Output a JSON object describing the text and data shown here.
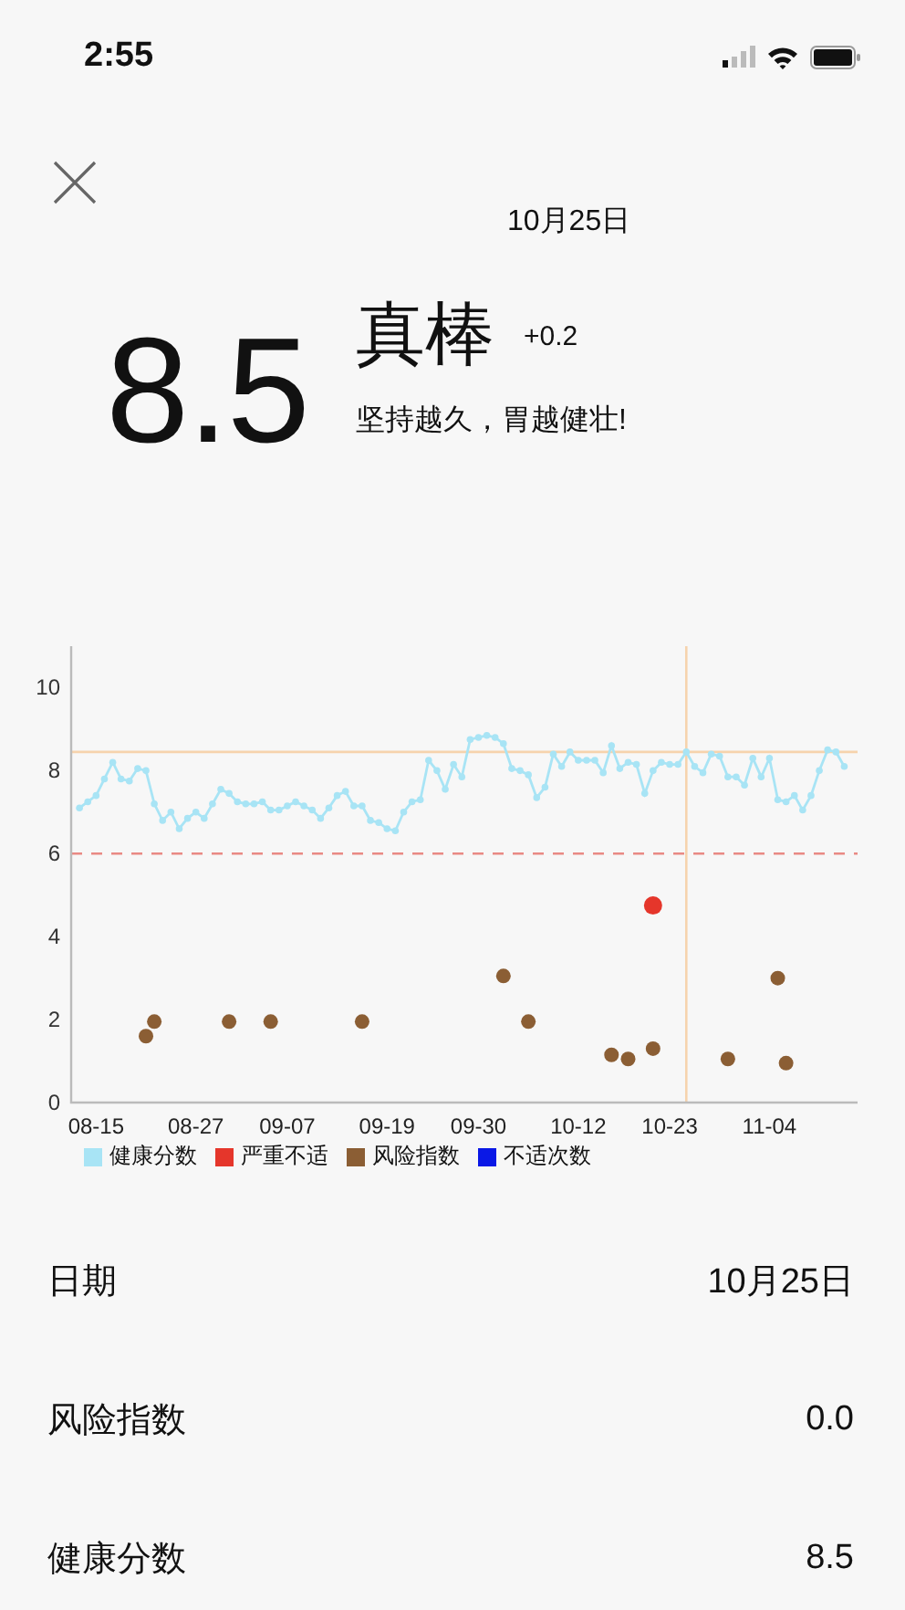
{
  "status_bar": {
    "time": "2:55"
  },
  "header": {
    "date": "10月25日",
    "score": "8.5",
    "rating": "真棒",
    "change": "+0.2",
    "message": "坚持越久，胃越健壮!"
  },
  "chart": {
    "chart_data": {
      "type": "line",
      "ylim": [
        0,
        11
      ],
      "yticks": [
        0,
        2,
        4,
        6,
        8,
        10
      ],
      "categories": [
        null,
        null,
        "08-15",
        null,
        null,
        null,
        null,
        null,
        null,
        null,
        null,
        null,
        null,
        null,
        "08-27",
        null,
        null,
        null,
        null,
        null,
        null,
        null,
        null,
        null,
        null,
        "09-07",
        null,
        null,
        null,
        null,
        null,
        null,
        null,
        null,
        null,
        null,
        null,
        "09-19",
        null,
        null,
        null,
        null,
        null,
        null,
        null,
        null,
        null,
        null,
        "09-30",
        null,
        null,
        null,
        null,
        null,
        null,
        null,
        null,
        null,
        null,
        null,
        "10-12",
        null,
        null,
        null,
        null,
        null,
        null,
        null,
        null,
        null,
        null,
        "10-23",
        null,
        null,
        null,
        null,
        null,
        null,
        null,
        null,
        null,
        null,
        null,
        "11-04",
        null,
        null,
        null,
        null,
        null,
        null,
        null,
        null,
        null
      ],
      "series": [
        {
          "name": "健康分数",
          "color": "#a8e4f5",
          "type": "line",
          "marker": true,
          "values": [
            7.1,
            7.25,
            7.4,
            7.8,
            8.2,
            7.8,
            7.75,
            8.05,
            8.0,
            7.2,
            6.8,
            7.0,
            6.6,
            6.85,
            7.0,
            6.85,
            7.2,
            7.55,
            7.45,
            7.25,
            7.2,
            7.2,
            7.25,
            7.05,
            7.05,
            7.15,
            7.25,
            7.15,
            7.05,
            6.85,
            7.1,
            7.4,
            7.5,
            7.15,
            7.15,
            6.8,
            6.75,
            6.6,
            6.55,
            7.0,
            7.25,
            7.3,
            8.25,
            8.0,
            7.55,
            8.15,
            7.85,
            8.75,
            8.8,
            8.85,
            8.8,
            8.65,
            8.05,
            8.0,
            7.9,
            7.35,
            7.6,
            8.4,
            8.1,
            8.45,
            8.25,
            8.25,
            8.25,
            7.95,
            8.6,
            8.05,
            8.2,
            8.15,
            7.45,
            8.0,
            8.2,
            8.15,
            8.15,
            8.45,
            8.1,
            7.95,
            8.4,
            8.35,
            7.85,
            7.85,
            7.65,
            8.3,
            7.85,
            8.3,
            7.3,
            7.25,
            7.4,
            7.05,
            7.4,
            8.0,
            8.5,
            8.45,
            8.1
          ]
        },
        {
          "name": "严重不适",
          "color": "#e5362b",
          "type": "scatter",
          "values": [
            null,
            null,
            null,
            null,
            null,
            null,
            null,
            null,
            null,
            null,
            null,
            null,
            null,
            null,
            null,
            null,
            null,
            null,
            null,
            null,
            null,
            null,
            null,
            null,
            null,
            null,
            null,
            null,
            null,
            null,
            null,
            null,
            null,
            null,
            null,
            null,
            null,
            null,
            null,
            null,
            null,
            null,
            null,
            null,
            null,
            null,
            null,
            null,
            null,
            null,
            null,
            null,
            null,
            null,
            null,
            null,
            null,
            null,
            null,
            null,
            null,
            null,
            null,
            null,
            null,
            null,
            null,
            null,
            null,
            4.75,
            null,
            null,
            null,
            null,
            null,
            null,
            null,
            null,
            null,
            null,
            null,
            null,
            null,
            null,
            null,
            null,
            null,
            null,
            null,
            null,
            null,
            null,
            null
          ]
        },
        {
          "name": "风险指数",
          "color": "#8b5e34",
          "type": "scatter",
          "values": [
            null,
            null,
            null,
            null,
            null,
            null,
            null,
            null,
            1.6,
            1.95,
            null,
            null,
            null,
            null,
            null,
            null,
            null,
            null,
            1.95,
            null,
            null,
            null,
            null,
            1.95,
            null,
            null,
            null,
            null,
            null,
            null,
            null,
            null,
            null,
            null,
            1.95,
            null,
            null,
            null,
            null,
            null,
            null,
            null,
            null,
            null,
            null,
            null,
            null,
            null,
            null,
            null,
            null,
            3.05,
            null,
            null,
            1.95,
            null,
            null,
            null,
            null,
            null,
            null,
            null,
            null,
            null,
            1.15,
            null,
            1.05,
            null,
            null,
            1.3,
            null,
            null,
            null,
            null,
            null,
            null,
            null,
            null,
            1.05,
            null,
            null,
            null,
            null,
            null,
            3.0,
            0.95,
            null,
            null,
            null,
            null,
            null,
            null,
            null
          ]
        },
        {
          "name": "不适次数",
          "color": "#0a18e6",
          "type": "scatter",
          "values": [
            null,
            null,
            null,
            null,
            null,
            null,
            null,
            null,
            null,
            null,
            null,
            null,
            null,
            null,
            null,
            null,
            null,
            null,
            null,
            null,
            null,
            null,
            null,
            null,
            null,
            null,
            null,
            null,
            null,
            null,
            null,
            null,
            null,
            null,
            null,
            null,
            null,
            null,
            null,
            null,
            null,
            null,
            null,
            null,
            null,
            null,
            null,
            null,
            null,
            null,
            null,
            null,
            null,
            null,
            null,
            null,
            null,
            null,
            null,
            null,
            null,
            null,
            null,
            null,
            null,
            null,
            null,
            null,
            null,
            null,
            null,
            null,
            null,
            null,
            null,
            null,
            null,
            null,
            null,
            null,
            null,
            null,
            null,
            null,
            null,
            null,
            null,
            null,
            null,
            null,
            null,
            null,
            null
          ]
        }
      ],
      "ref_lines": [
        {
          "axis": "y",
          "value": 8.45
        },
        {
          "axis": "y",
          "value": 6
        }
      ]
    }
  },
  "details": [
    {
      "label": "日期",
      "value": "10月25日"
    },
    {
      "label": "风险指数",
      "value": "0.0"
    },
    {
      "label": "健康分数",
      "value": "8.5"
    }
  ]
}
